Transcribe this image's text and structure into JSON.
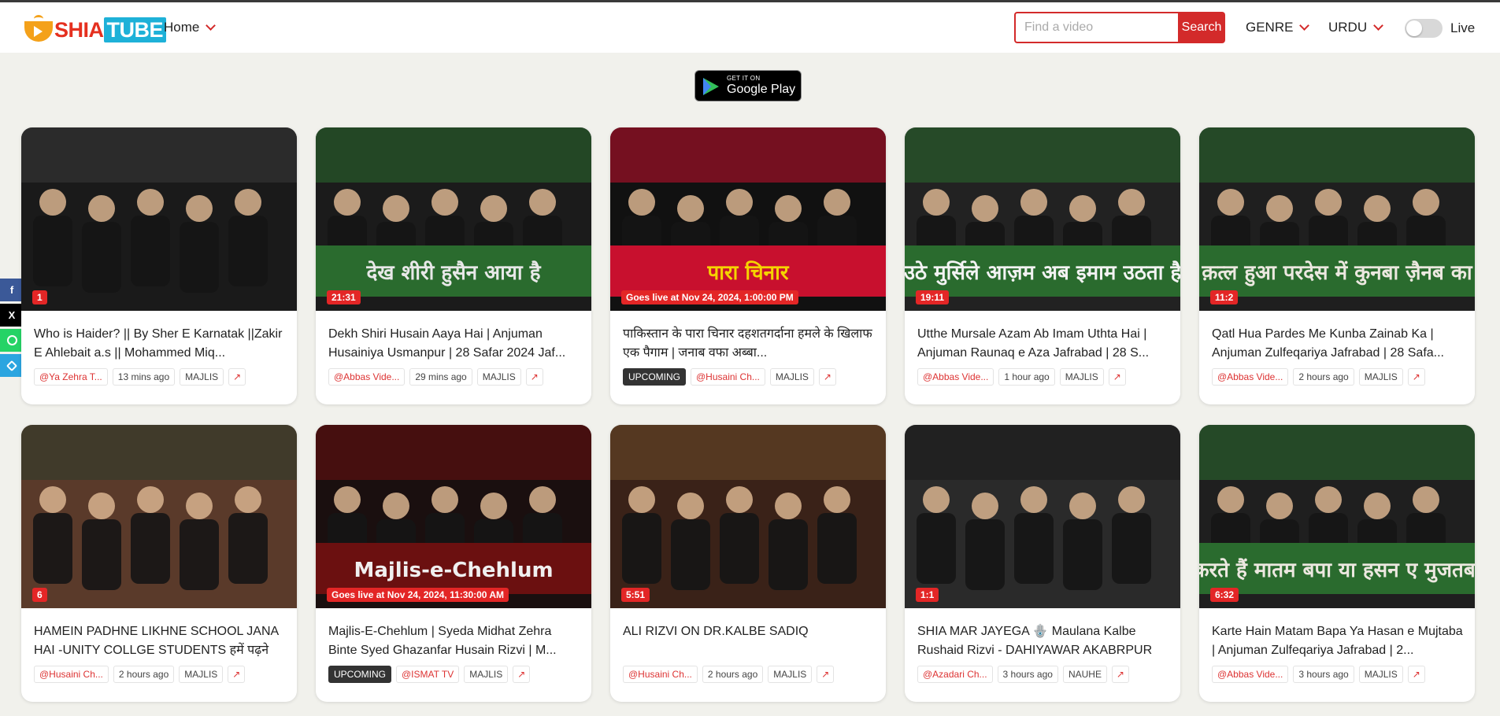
{
  "brand": {
    "part1": "SHIA",
    "part2": "TUBE"
  },
  "nav": {
    "home": "Home"
  },
  "search": {
    "placeholder": "Find a video",
    "button": "Search"
  },
  "filters": {
    "genre": "GENRE",
    "language": "URDU",
    "live": "Live",
    "live_enabled": false
  },
  "store": {
    "line1": "GET IT ON",
    "line2": "Google Play"
  },
  "share": {
    "facebook": "f",
    "x": "X",
    "whatsapp": "",
    "telegram": ""
  },
  "cards": [
    {
      "badge": "1",
      "title": "Who is Haider? || By Sher E Karnatak ||Zakir E Ahlebait a.s || Mohammed Miq...",
      "channel": "@Ya Zehra T...",
      "time": "13 mins ago",
      "genre": "MAJLIS",
      "upcoming": "",
      "thumb_text": ""
    },
    {
      "badge": "21:31",
      "title": "Dekh Shiri Husain Aaya Hai | Anjuman Husainiya Usmanpur | 28 Safar 2024 Jaf...",
      "channel": "@Abbas Vide...",
      "time": "29 mins ago",
      "genre": "MAJLIS",
      "upcoming": "",
      "thumb_text": "देख शीरी हुसैन आया है"
    },
    {
      "badge": "Goes live at Nov 24, 2024, 1:00:00 PM",
      "title": "पाकिस्तान के पारा चिनार दहशतगर्दाना हमले के खिलाफ एक पैगाम | जनाब वफा अब्बा...",
      "channel": "@Husaini Ch...",
      "time": "",
      "genre": "MAJLIS",
      "upcoming": "UPCOMING",
      "thumb_text": "पारा चिनार"
    },
    {
      "badge": "19:11",
      "title": "Utthe Mursale Azam Ab Imam Uthta Hai | Anjuman Raunaq e Aza Jafrabad | 28 S...",
      "channel": "@Abbas Vide...",
      "time": "1 hour ago",
      "genre": "MAJLIS",
      "upcoming": "",
      "thumb_text": "उठे मुर्सिले आज़म अब इमाम उठता है"
    },
    {
      "badge": "11:2",
      "title": "Qatl Hua Pardes Me Kunba Zainab Ka | Anjuman Zulfeqariya Jafrabad | 28 Safa...",
      "channel": "@Abbas Vide...",
      "time": "2 hours ago",
      "genre": "MAJLIS",
      "upcoming": "",
      "thumb_text": "क़त्ल हुआ परदेस में कुनबा ज़ैनब का"
    },
    {
      "badge": "6",
      "title": "HAMEIN PADHNE LIKHNE SCHOOL JANA HAI -UNITY COLLGE STUDENTS हमें पढ़ने लिखने",
      "channel": "@Husaini Ch...",
      "time": "2 hours ago",
      "genre": "MAJLIS",
      "upcoming": "",
      "thumb_text": ""
    },
    {
      "badge": "Goes live at Nov 24, 2024, 11:30:00 AM",
      "title": "Majlis-E-Chehlum | Syeda Midhat Zehra Binte Syed Ghazanfar Husain Rizvi | M...",
      "channel": "@ISMAT TV",
      "time": "",
      "genre": "MAJLIS",
      "upcoming": "UPCOMING",
      "thumb_text": "Majlis-e-Chehlum"
    },
    {
      "badge": "5:51",
      "title": "ALI RIZVI ON DR.KALBE SADIQ",
      "channel": "@Husaini Ch...",
      "time": "2 hours ago",
      "genre": "MAJLIS",
      "upcoming": "",
      "thumb_text": ""
    },
    {
      "badge": "1:1",
      "title": "SHIA MAR JAYEGA 🪬 Maulana Kalbe Rushaid Rizvi - DAHIYAWAR AKABRPUR",
      "channel": "@Azadari Ch...",
      "time": "3 hours ago",
      "genre": "NAUHE",
      "upcoming": "",
      "thumb_text": ""
    },
    {
      "badge": "6:32",
      "title": "Karte Hain Matam Bapa Ya Hasan e Mujtaba | Anjuman Zulfeqariya Jafrabad | 2...",
      "channel": "@Abbas Vide...",
      "time": "3 hours ago",
      "genre": "MAJLIS",
      "upcoming": "",
      "thumb_text": "करते हैं मातम बपा या हसन ए मुजतबा"
    }
  ],
  "colors": {
    "accent": "#d32a2a",
    "badge": "#e32626",
    "background": "#f1f1ec"
  }
}
